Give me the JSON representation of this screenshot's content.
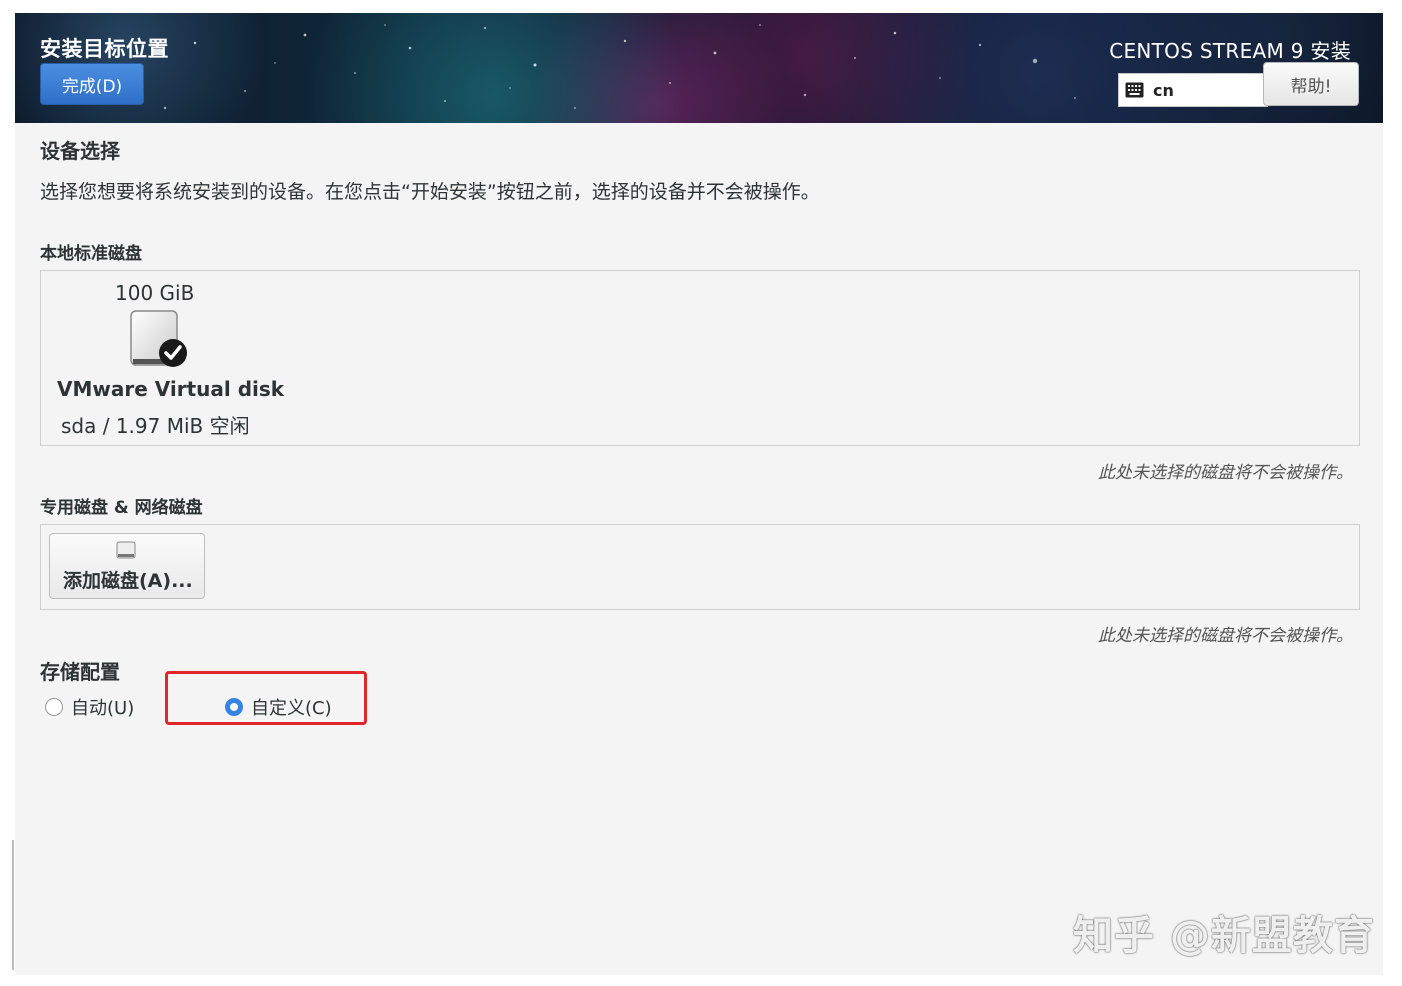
{
  "header": {
    "page_title": "安装目标位置",
    "done_button": "完成(D)",
    "product_title": "CENTOS STREAM 9 安装",
    "keyboard_layout": "cn",
    "help_button": "帮助!"
  },
  "device_selection": {
    "title": "设备选择",
    "intro": "选择您想要将系统安装到的设备。在您点击“开始安装”按钮之前，选择的设备并不会被操作。",
    "local_disks": {
      "title": "本地标准磁盘",
      "disks": [
        {
          "size": "100 GiB",
          "name": "VMware Virtual disk",
          "detail": "sda  /  1.97 MiB 空闲",
          "selected": true,
          "icon": "hard-disk-checked-icon"
        }
      ],
      "note": "此处未选择的磁盘将不会被操作。"
    },
    "specialized_disks": {
      "title": "专用磁盘 & 网络磁盘",
      "add_button": "添加磁盘(A)...",
      "add_icon": "disk-icon",
      "note": "此处未选择的磁盘将不会被操作。"
    }
  },
  "storage_config": {
    "title": "存储配置",
    "options": [
      {
        "label": "自动(U)",
        "checked": false
      },
      {
        "label": "自定义(C)",
        "checked": true
      }
    ]
  },
  "watermark": "知乎 @新盟教育",
  "colors": {
    "accent": "#3584e4",
    "done_button": "#3a7dd6",
    "highlight": "#e0262c",
    "background": "#f4f4f4"
  }
}
